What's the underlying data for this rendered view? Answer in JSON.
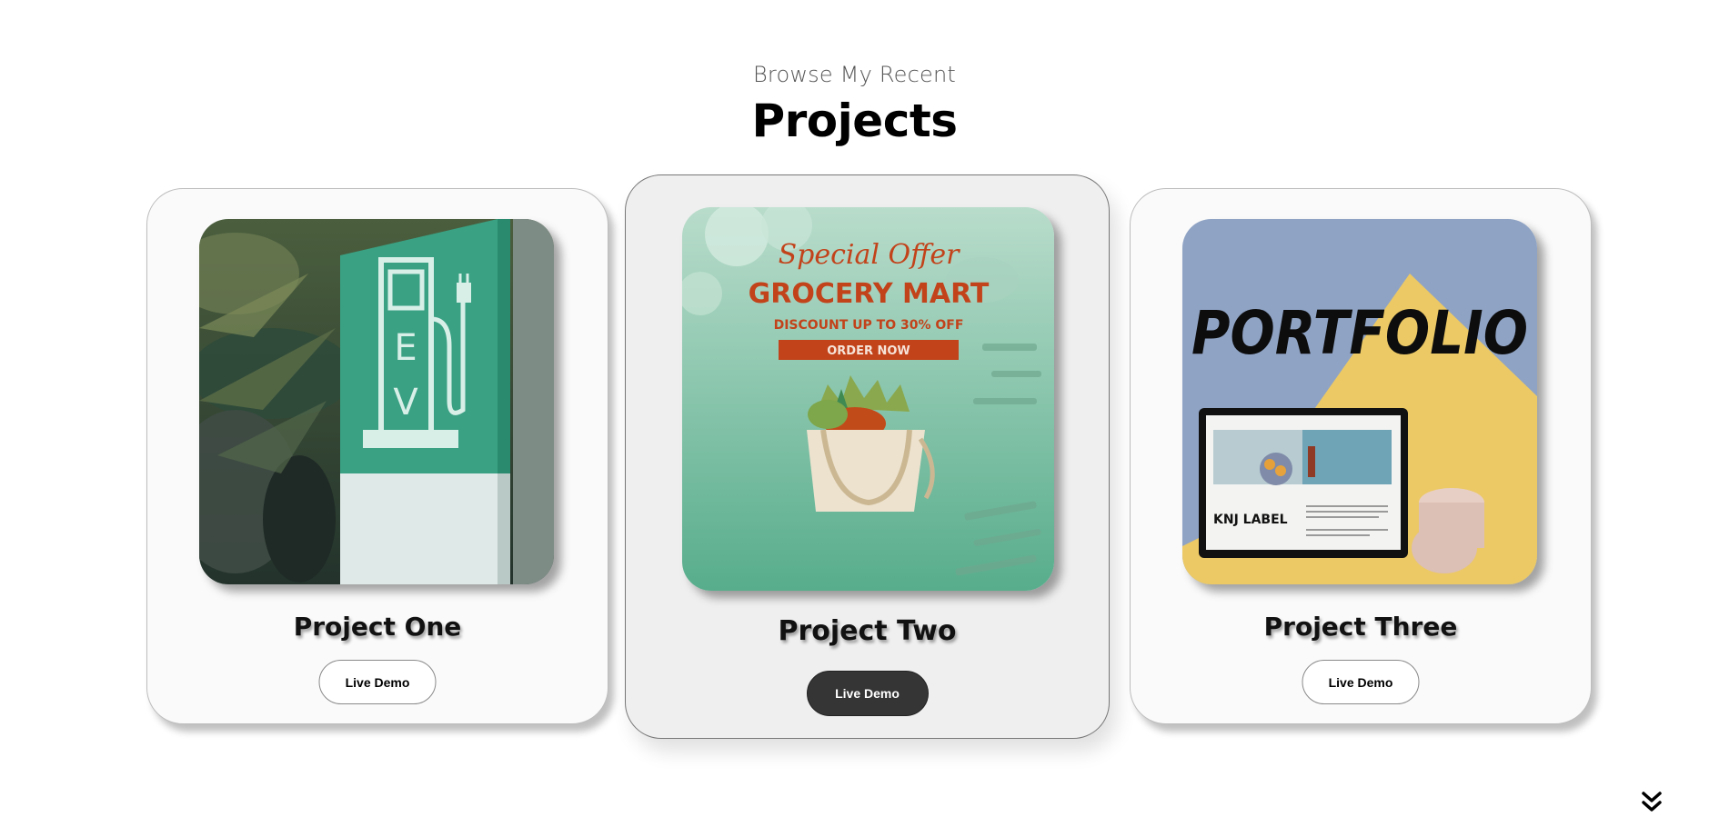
{
  "header": {
    "subtitle": "Browse My Recent",
    "title": "Projects"
  },
  "projects": [
    {
      "title": "Project One",
      "button_label": "Live Demo",
      "image": {
        "sign_letters": [
          "E",
          "V"
        ]
      }
    },
    {
      "title": "Project Two",
      "button_label": "Live Demo",
      "image": {
        "script_text": "Special Offer",
        "headline": "GROCERY MART",
        "subline": "DISCOUNT UP TO 30% OFF",
        "cta": "ORDER NOW"
      }
    },
    {
      "title": "Project Three",
      "button_label": "Live Demo",
      "image": {
        "headline": "PORTFOLIO",
        "tablet_label": "KNJ LABEL"
      }
    }
  ],
  "colors": {
    "active_button_bg": "#353535",
    "card_bg": "#fafafa",
    "ev_green": "#3a9c82",
    "grocery_red": "#c2421a"
  },
  "icons": {
    "scroll": "double-chevron-down-icon"
  }
}
